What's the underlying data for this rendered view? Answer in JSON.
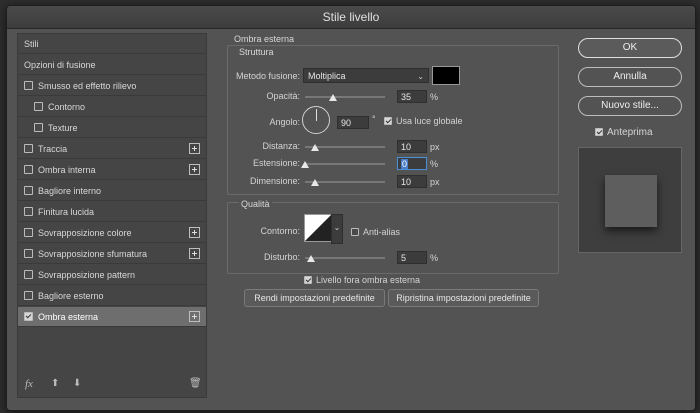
{
  "window": {
    "title": "Stile livello"
  },
  "left_panel": {
    "items": [
      {
        "label": "Stili",
        "indent": false,
        "checkbox": false,
        "checked": false,
        "plus": false,
        "selected": false
      },
      {
        "label": "Opzioni di fusione",
        "indent": false,
        "checkbox": false,
        "checked": false,
        "plus": false,
        "selected": false
      },
      {
        "label": "Smusso ed effetto rilievo",
        "indent": false,
        "checkbox": true,
        "checked": false,
        "plus": false,
        "selected": false
      },
      {
        "label": "Contorno",
        "indent": true,
        "checkbox": true,
        "checked": false,
        "plus": false,
        "selected": false
      },
      {
        "label": "Texture",
        "indent": true,
        "checkbox": true,
        "checked": false,
        "plus": false,
        "selected": false
      },
      {
        "label": "Traccia",
        "indent": false,
        "checkbox": true,
        "checked": false,
        "plus": true,
        "selected": false
      },
      {
        "label": "Ombra interna",
        "indent": false,
        "checkbox": true,
        "checked": false,
        "plus": true,
        "selected": false
      },
      {
        "label": "Bagliore interno",
        "indent": false,
        "checkbox": true,
        "checked": false,
        "plus": false,
        "selected": false
      },
      {
        "label": "Finitura lucida",
        "indent": false,
        "checkbox": true,
        "checked": false,
        "plus": false,
        "selected": false
      },
      {
        "label": "Sovrapposizione colore",
        "indent": false,
        "checkbox": true,
        "checked": false,
        "plus": true,
        "selected": false
      },
      {
        "label": "Sovrapposizione sfumatura",
        "indent": false,
        "checkbox": true,
        "checked": false,
        "plus": true,
        "selected": false
      },
      {
        "label": "Sovrapposizione pattern",
        "indent": false,
        "checkbox": true,
        "checked": false,
        "plus": false,
        "selected": false
      },
      {
        "label": "Bagliore esterno",
        "indent": false,
        "checkbox": true,
        "checked": false,
        "plus": false,
        "selected": false
      },
      {
        "label": "Ombra esterna",
        "indent": false,
        "checkbox": true,
        "checked": true,
        "plus": true,
        "selected": true
      }
    ],
    "footer_icons": [
      "fx-icon",
      "arrow-up-icon",
      "arrow-down-icon",
      "trash-icon"
    ],
    "fx_label": "fx"
  },
  "effect": {
    "title": "Ombra esterna",
    "structure": {
      "title": "Struttura",
      "blend_mode_label": "Metodo fusione:",
      "blend_mode_value": "Moltiplica",
      "color": "#000000",
      "opacity_label": "Opacità:",
      "opacity_value": "35",
      "opacity_unit": "%",
      "opacity_level": 0.35,
      "angle_label": "Angolo:",
      "angle_value": "90",
      "angle_unit": "°",
      "global_light_label": "Usa luce globale",
      "global_light_checked": true,
      "distance_label": "Distanza:",
      "distance_value": "10",
      "distance_unit": "px",
      "spread_label": "Estensione:",
      "spread_value": "0",
      "spread_unit": "%",
      "size_label": "Dimensione:",
      "size_value": "10",
      "size_unit": "px"
    },
    "quality": {
      "title": "Qualità",
      "contour_label": "Contorno:",
      "antialias_label": "Anti-alias",
      "antialias_checked": false,
      "noise_label": "Disturbo:",
      "noise_value": "5",
      "noise_unit": "%"
    },
    "layer_knocks_out_label": "Livello fora ombra esterna",
    "layer_knocks_out_checked": true,
    "make_default_label": "Rendi impostazioni predefinite",
    "reset_default_label": "Ripristina impostazioni predefinite"
  },
  "right_panel": {
    "ok_label": "OK",
    "cancel_label": "Annulla",
    "new_style_label": "Nuovo stile...",
    "preview_label": "Anteprima",
    "preview_checked": true
  }
}
